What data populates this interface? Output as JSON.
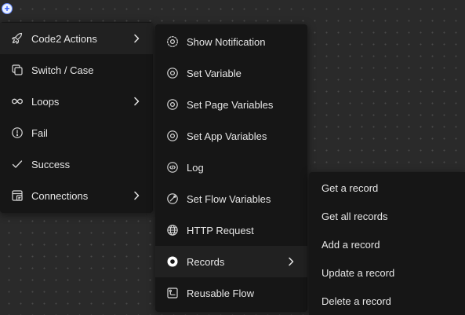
{
  "canvas": {
    "add_icon": "plus-icon",
    "add_glyph": "+"
  },
  "menu_level1": {
    "items": [
      {
        "label": "Code2 Actions",
        "icon": "rocket-icon",
        "has_submenu": true,
        "active": true
      },
      {
        "label": "Switch / Case",
        "icon": "copy-icon",
        "has_submenu": false
      },
      {
        "label": "Loops",
        "icon": "infinity-icon",
        "has_submenu": true
      },
      {
        "label": "Fail",
        "icon": "alert-circle-icon",
        "has_submenu": false
      },
      {
        "label": "Success",
        "icon": "check-icon",
        "has_submenu": false
      },
      {
        "label": "Connections",
        "icon": "connections-icon",
        "has_submenu": true
      }
    ]
  },
  "menu_level2": {
    "items": [
      {
        "label": "Show Notification",
        "icon": "notification-icon"
      },
      {
        "label": "Set Variable",
        "icon": "variable-icon"
      },
      {
        "label": "Set Page Variables",
        "icon": "variable-icon"
      },
      {
        "label": "Set App Variables",
        "icon": "variable-icon"
      },
      {
        "label": "Log",
        "icon": "code-icon"
      },
      {
        "label": "Set Flow Variables",
        "icon": "flow-variable-icon"
      },
      {
        "label": "HTTP Request",
        "icon": "globe-icon"
      },
      {
        "label": "Records",
        "icon": "records-icon",
        "has_submenu": true,
        "active": true
      },
      {
        "label": "Reusable Flow",
        "icon": "reusable-flow-icon"
      }
    ]
  },
  "menu_level3": {
    "items": [
      {
        "label": "Get a record"
      },
      {
        "label": "Get all records"
      },
      {
        "label": "Add a record"
      },
      {
        "label": "Update a record"
      },
      {
        "label": "Delete a record"
      }
    ]
  },
  "colors": {
    "canvas_bg": "#2a2a2a",
    "menu_bg": "#161616",
    "active_bg": "#212121",
    "text": "#e6e6e6",
    "accent": "#2f5bff"
  }
}
